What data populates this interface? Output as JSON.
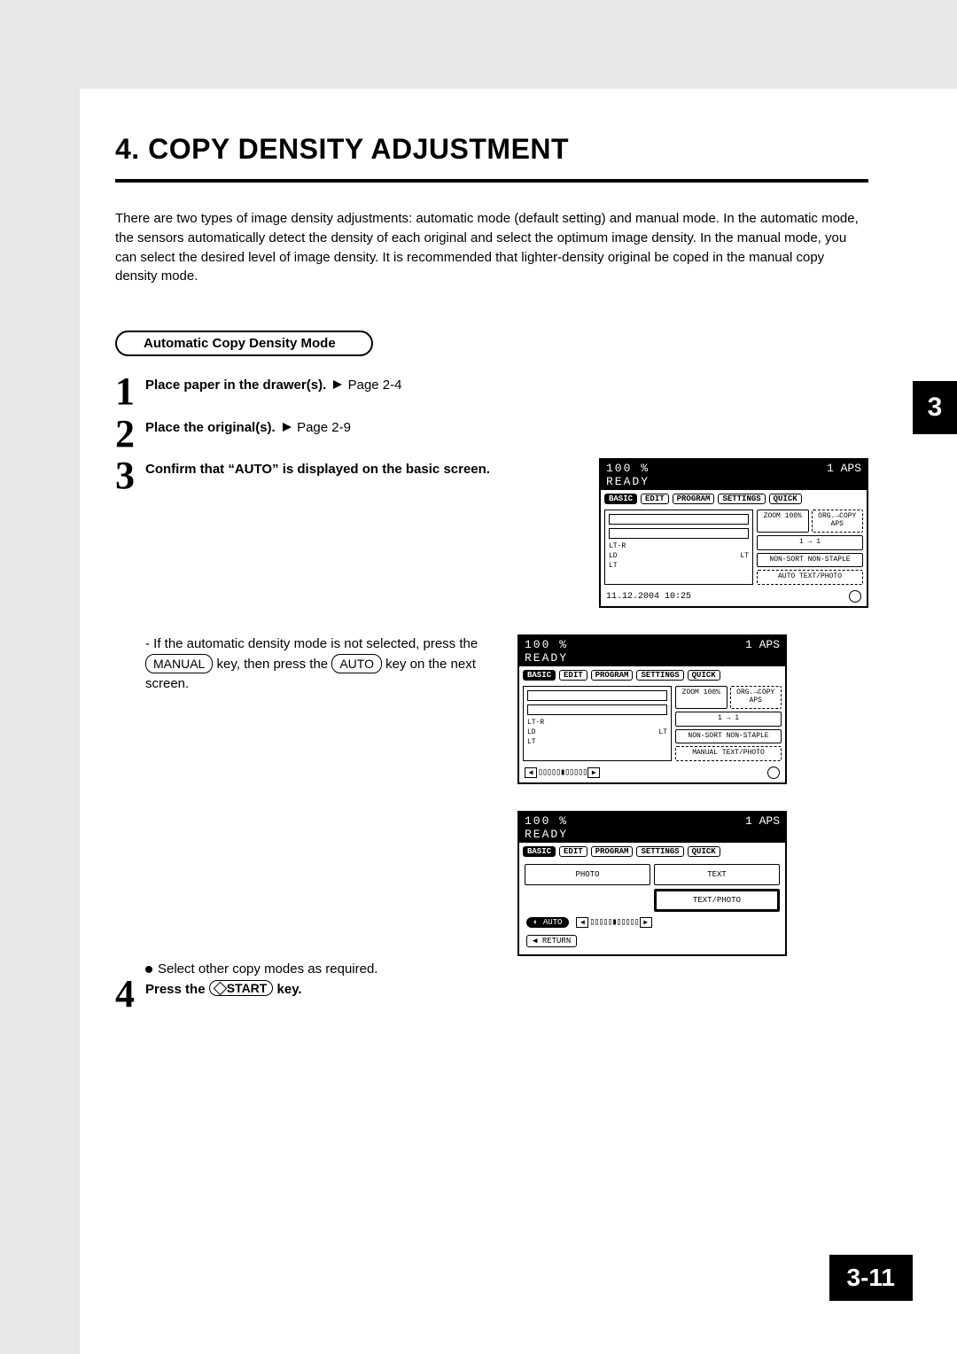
{
  "heading": "4. COPY DENSITY ADJUSTMENT",
  "intro": "There are two types of image density adjustments: automatic mode (default setting) and manual mode. In the automatic mode, the sensors automatically detect the density of each original and select the optimum image density. In the manual mode, you can select the desired level of image density. It is recommended that lighter-density original be coped in the manual copy density mode.",
  "pill": "Automatic Copy Density Mode",
  "steps": {
    "s1_bold": "Place paper in the drawer(s).",
    "s1_ref": "Page 2-4",
    "s2_bold": "Place the original(s).",
    "s2_ref": "Page 2-9",
    "s3_bold": "Confirm that “AUTO” is displayed on the basic screen.",
    "sub_dash": "- If the automatic density mode is not selected, press the ",
    "manual_key": "MANUAL",
    "sub_mid": " key, then press the ",
    "auto_key": "AUTO",
    "sub_end": " key on the next screen.",
    "bullet": "Select other copy modes as required.",
    "s4_pre": "Press the ",
    "start_key": "START",
    "s4_post": " key."
  },
  "panel_common": {
    "header_left_top": "100 %",
    "header_count": "1",
    "header_aps": "APS",
    "ready": "READY",
    "tabs": [
      "BASIC",
      "EDIT",
      "PROGRAM",
      "SETTINGS",
      "QUICK"
    ],
    "trays": [
      "LT-R",
      "LD",
      "LT"
    ],
    "tray_lt": "LT",
    "rbtn_zoom": "ZOOM 100%",
    "rbtn_org": "ORG.→COPY APS",
    "rbtn_11": "1 → 1",
    "rbtn_nonsort": "NON-SORT NON-STAPLE",
    "rbtn_auto": "AUTO TEXT/PHOTO",
    "rbtn_manual": "MANUAL TEXT/PHOTO",
    "timestamp": "11.12.2004 10:25"
  },
  "panel3": {
    "photo": "PHOTO",
    "text": "TEXT",
    "textphoto": "TEXT/PHOTO",
    "auto": "AUTO",
    "return": "RETURN"
  },
  "tab_index": "3",
  "page_number": "3-11"
}
